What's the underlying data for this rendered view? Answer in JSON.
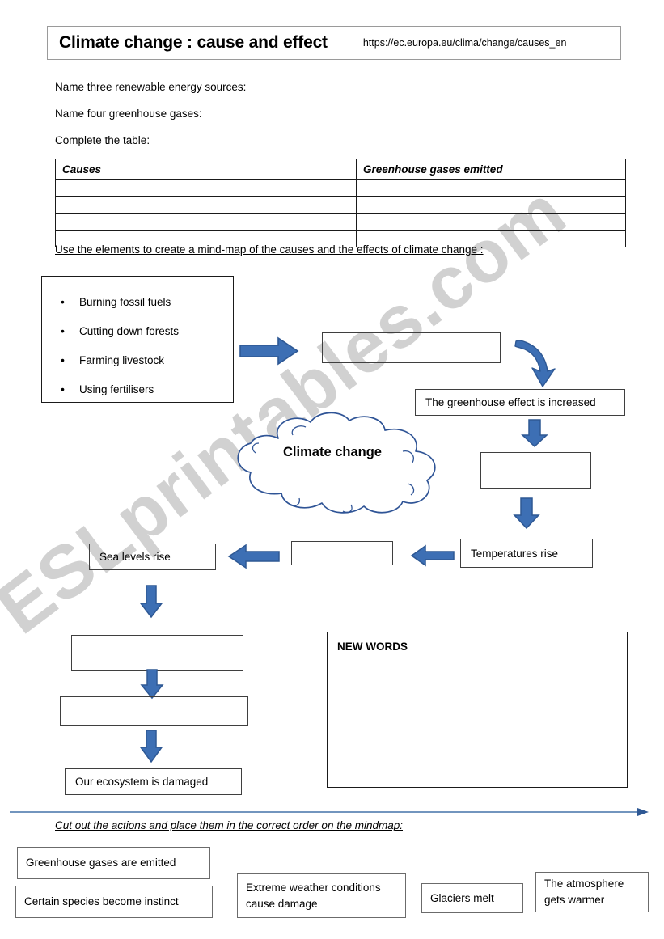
{
  "header": {
    "title": "Climate change : cause and effect",
    "url": "https://ec.europa.eu/clima/change/causes_en"
  },
  "prompts": [
    "Name three renewable energy sources:",
    "Name four greenhouse gases:",
    "Complete the table:"
  ],
  "table": {
    "headers": [
      "Causes",
      "Greenhouse gases emitted"
    ],
    "rows": [
      [
        "",
        ""
      ],
      [
        "",
        ""
      ],
      [
        "",
        ""
      ],
      [
        "",
        ""
      ]
    ]
  },
  "mindmap": {
    "instruction": "Use the elements to create a mind-map of the causes and the effects of climate change :",
    "causes": [
      "Burning fossil fuels",
      "Cutting down forests",
      "Farming livestock",
      "Using fertilisers"
    ],
    "cloud_label": "Climate change",
    "boxes": {
      "empty_1": "",
      "greenhouse": "The greenhouse effect is increased",
      "empty_2": "",
      "temperatures": "Temperatures rise",
      "empty_3": "",
      "sea_levels": "Sea levels rise",
      "empty_4": "",
      "empty_5": "",
      "ecosystem": "Our ecosystem is damaged"
    }
  },
  "new_words": {
    "label": "NEW WORDS",
    "content": ""
  },
  "cut_section": {
    "instruction": "Cut out the actions and place them in the correct order on the mindmap:",
    "cards": [
      "Greenhouse gases  are emitted",
      "Certain species become instinct",
      "Extreme weather conditions cause damage",
      "Glaciers melt",
      "The atmosphere gets warmer"
    ]
  },
  "watermark": {
    "text": "ESLprintables.com"
  },
  "colors": {
    "arrow_fill": "#3d6fb4",
    "arrow_stroke": "#2e5894",
    "cloud_stroke": "#2f5496",
    "divider": "#4472a8",
    "box_border": "#3f3f3f"
  }
}
